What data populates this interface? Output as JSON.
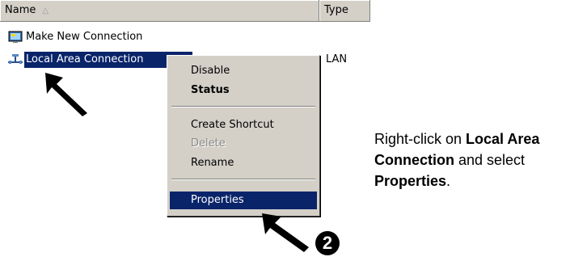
{
  "header": {
    "col_name": "Name",
    "col_name_sort_icon": "sort-ascending-icon",
    "col_type": "Type"
  },
  "rows": [
    {
      "label": "Make New Connection",
      "icon": "new-connection-icon",
      "type": ""
    },
    {
      "label": "Local Area Connection",
      "icon": "network-connection-icon",
      "type": "LAN"
    }
  ],
  "context_menu": {
    "items": [
      {
        "label": "Disable",
        "state": "normal"
      },
      {
        "label": "Status",
        "state": "default"
      },
      {
        "label": "Create Shortcut",
        "state": "normal"
      },
      {
        "label": "Delete",
        "state": "disabled"
      },
      {
        "label": "Rename",
        "state": "normal"
      },
      {
        "label": "Properties",
        "state": "highlighted"
      }
    ]
  },
  "instruction": {
    "part1": "Right-click on ",
    "bold1": "Local Area Connection",
    "part2": " and select ",
    "bold2": "Properties",
    "part3": "."
  },
  "callout": {
    "step_number": "2"
  },
  "colors": {
    "selection": "#0a246a",
    "menu_bg": "#d4d0c8",
    "disabled_text": "#8a8a8a"
  }
}
